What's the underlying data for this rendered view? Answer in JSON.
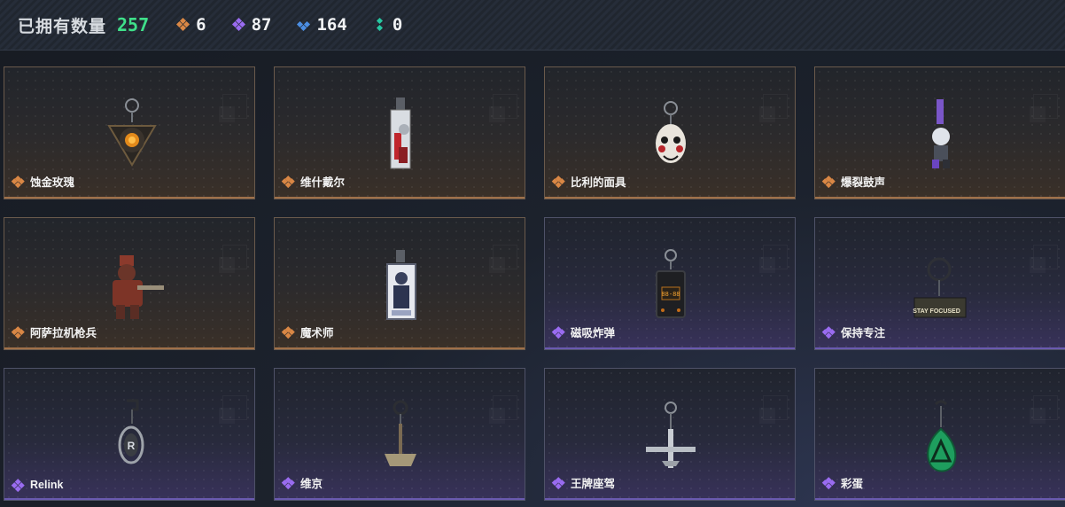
{
  "header": {
    "owned_label": "已拥有数量",
    "owned_count": "257",
    "stats": [
      {
        "icon": "orange-gem-icon",
        "color": "#d98745",
        "value": "6"
      },
      {
        "icon": "purple-gem-icon",
        "color": "#9a6cf0",
        "value": "87"
      },
      {
        "icon": "blue-gem-icon",
        "color": "#4b8ee3",
        "value": "164"
      },
      {
        "icon": "teal-gem-icon",
        "color": "#27c7a2",
        "value": "0"
      }
    ]
  },
  "items": [
    {
      "name": "蚀金玫瑰",
      "rarity": "orange",
      "icon": "gold-rose-charm-icon"
    },
    {
      "name": "维什戴尔",
      "rarity": "orange",
      "icon": "card-charm-icon"
    },
    {
      "name": "比利的面具",
      "rarity": "orange",
      "icon": "billy-mask-charm-icon"
    },
    {
      "name": "爆裂鼓声",
      "rarity": "orange",
      "icon": "figure-charm-icon"
    },
    {
      "name": "阿萨拉机枪兵",
      "rarity": "orange",
      "icon": "gunner-figure-charm-icon"
    },
    {
      "name": "魔术师",
      "rarity": "orange",
      "icon": "magician-card-charm-icon"
    },
    {
      "name": "磁吸炸弹",
      "rarity": "purple",
      "icon": "bomb-charm-icon"
    },
    {
      "name": "保持专注",
      "rarity": "purple",
      "icon": "stay-focused-charm-icon"
    },
    {
      "name": "Relink",
      "rarity": "purple",
      "icon": "relink-charm-icon"
    },
    {
      "name": "维京",
      "rarity": "purple",
      "icon": "viking-axe-charm-icon"
    },
    {
      "name": "王牌座驾",
      "rarity": "purple",
      "icon": "jet-charm-icon"
    },
    {
      "name": "彩蛋",
      "rarity": "purple",
      "icon": "green-egg-charm-icon"
    }
  ],
  "art_text": {
    "stay_focused": "STAY FOCUSED",
    "bomb_code": "88-88",
    "relink_letter": "R"
  }
}
